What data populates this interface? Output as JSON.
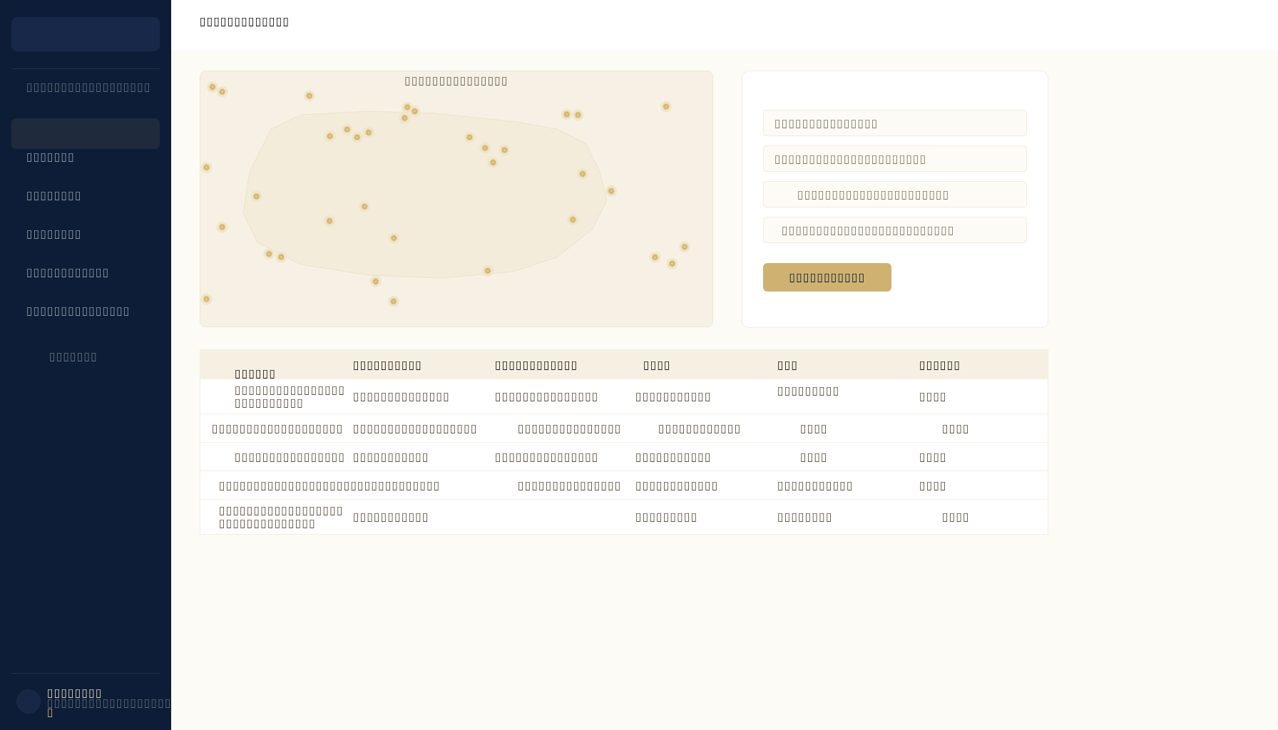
{
  "sidebar": {
    "section_label": "▯▯▯▯▯▯▯▯▯▯▯▯▯▯▯▯▯▯",
    "items": [
      {
        "label": "▯▯▯▯▯▯▯",
        "selected": true
      },
      {
        "label": "▯▯▯▯▯▯▯▯",
        "selected": false
      },
      {
        "label": "▯▯▯▯▯▯▯▯",
        "selected": false
      },
      {
        "label": "▯▯▯▯▯▯▯▯▯▯▯▯",
        "selected": false
      },
      {
        "label": "▯▯▯▯▯▯▯▯▯▯▯▯▯▯▯",
        "selected": false,
        "children": [
          {
            "label": "▯▯▯▯▯▯▯",
            "selected": false
          }
        ]
      }
    ],
    "user": {
      "name": "▯▯▯▯▯▯▯▯",
      "detail": "▯▯▯▯▯▯▯▯▯▯▯▯▯▯▯▯▯▯",
      "role": "▯"
    }
  },
  "header": {
    "title": "▯▯▯▯▯▯▯▯▯▯▯▯▯"
  },
  "map_panel": {
    "title": "▯▯▯▯▯▯▯▯▯▯▯▯▯▯▯"
  },
  "form": {
    "fields": [
      {
        "placeholder": "▯▯▯▯▯▯▯▯▯▯▯▯▯▯▯"
      },
      {
        "placeholder": "▯▯▯▯▯▯▯▯▯▯▯▯▯▯▯▯▯▯▯▯▯▯"
      },
      {
        "placeholder": "▯▯▯▯▯▯▯▯▯▯▯▯▯▯▯▯▯▯▯▯▯▯"
      },
      {
        "placeholder": "▯▯▯▯▯▯▯▯▯▯▯▯▯▯▯▯▯▯▯▯▯▯▯▯▯"
      }
    ],
    "button": "▯▯▯▯▯▯▯▯▯▯▯"
  },
  "table": {
    "columns": [
      "▯▯▯▯▯▯",
      "▯▯▯▯▯▯▯▯▯▯",
      "▯▯▯▯▯▯▯▯▯▯▯▯",
      "▯▯▯▯",
      "▯▯▯",
      "▯▯▯▯▯▯"
    ],
    "rows": [
      {
        "column_1": "▯▯▯▯▯▯▯▯▯▯▯▯▯▯▯▯▯▯▯▯▯▯▯▯▯▯",
        "column_2": "▯▯▯▯▯▯▯▯▯▯▯▯▯▯",
        "column_3": "▯▯▯▯▯▯▯▯▯▯▯▯▯▯▯",
        "column_4": "▯▯▯▯▯▯▯▯▯▯▯",
        "column_5": "▯▯▯▯▯▯▯▯▯",
        "column_6": "▯▯▯▯"
      },
      {
        "column_1": "▯▯▯▯▯▯▯▯▯▯▯▯▯▯▯▯▯▯▯",
        "column_2": "▯▯▯▯▯▯▯▯▯▯▯▯▯▯▯▯▯▯",
        "column_3": "▯▯▯▯▯▯▯▯▯▯▯▯▯▯▯",
        "column_4": "▯▯▯▯▯▯▯▯▯▯▯▯",
        "column_5": "▯▯▯▯",
        "column_6": "▯▯▯▯"
      },
      {
        "column_1": "▯▯▯▯▯▯▯▯▯▯▯▯▯▯▯▯",
        "column_2": "▯▯▯▯▯▯▯▯▯▯▯",
        "column_3": "▯▯▯▯▯▯▯▯▯▯▯▯▯▯▯",
        "column_4": "▯▯▯▯▯▯▯▯▯▯▯",
        "column_5": "▯▯▯▯",
        "column_6": "▯▯▯▯"
      },
      {
        "column_1": "▯▯▯▯▯▯▯▯▯▯▯▯▯▯▯▯▯▯▯▯▯▯▯▯▯▯▯▯▯▯▯▯",
        "column_3": "▯▯▯▯▯▯▯▯▯▯▯▯▯▯▯",
        "column_4": "▯▯▯▯▯▯▯▯▯▯▯▯",
        "column_5": "▯▯▯▯▯▯▯▯▯▯▯",
        "column_6": "▯▯▯▯"
      },
      {
        "column_1": "▯▯▯▯▯▯▯▯▯▯▯▯▯▯▯▯▯▯▯▯▯▯▯▯▯▯▯▯▯▯▯▯",
        "column_2": "▯▯▯▯▯▯▯▯▯▯▯",
        "column_4": "▯▯▯▯▯▯▯▯▯",
        "column_5": "▯▯▯▯▯▯▯▯",
        "column_6": "▯▯▯▯"
      }
    ]
  }
}
